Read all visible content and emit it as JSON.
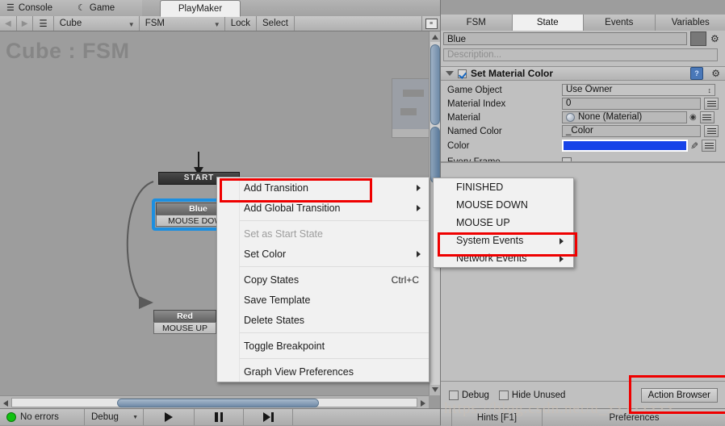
{
  "window_tabs": [
    {
      "label": "Console",
      "icon": "console-icon",
      "active": false
    },
    {
      "label": "Game",
      "icon": "game-icon",
      "active": false
    },
    {
      "label": "PlayMaker",
      "icon": "",
      "active": true
    }
  ],
  "graph_toolbar": {
    "back_icon": "left-arrow-icon",
    "forward_icon": "right-arrow-icon",
    "menu_icon": "hamburger-icon",
    "object_dropdown": "Cube",
    "fsm_dropdown": "FSM",
    "lock_label": "Lock",
    "select_label": "Select",
    "layout_icon": "layout-icon"
  },
  "graph": {
    "title": "Cube : FSM",
    "start_node": "START",
    "states": [
      {
        "name": "Blue",
        "event": "MOUSE DOWN",
        "selected": true
      },
      {
        "name": "Red",
        "event": "MOUSE UP",
        "selected": false
      }
    ]
  },
  "context_menu": {
    "items": [
      {
        "label": "Add Transition",
        "submenu": true,
        "disabled": false,
        "shortcut": "",
        "highlighted": true
      },
      {
        "label": "Add Global Transition",
        "submenu": true,
        "disabled": false,
        "shortcut": ""
      },
      {
        "separator": true
      },
      {
        "label": "Set as Start State",
        "submenu": false,
        "disabled": true,
        "shortcut": ""
      },
      {
        "label": "Set Color",
        "submenu": true,
        "disabled": false,
        "shortcut": ""
      },
      {
        "separator": true
      },
      {
        "label": "Copy States",
        "submenu": false,
        "disabled": false,
        "shortcut": "Ctrl+C"
      },
      {
        "label": "Save Template",
        "submenu": false,
        "disabled": false,
        "shortcut": ""
      },
      {
        "label": "Delete States",
        "submenu": false,
        "disabled": false,
        "shortcut": ""
      },
      {
        "separator": true
      },
      {
        "label": "Toggle Breakpoint",
        "submenu": false,
        "disabled": false,
        "shortcut": ""
      },
      {
        "separator": true
      },
      {
        "label": "Graph View Preferences",
        "submenu": false,
        "disabled": false,
        "shortcut": ""
      }
    ]
  },
  "submenu": {
    "items": [
      {
        "label": "FINISHED",
        "submenu": false
      },
      {
        "label": "MOUSE DOWN",
        "submenu": false
      },
      {
        "label": "MOUSE UP",
        "submenu": false
      },
      {
        "label": "System Events",
        "submenu": true,
        "highlighted": true
      },
      {
        "label": "Network Events",
        "submenu": true
      }
    ]
  },
  "status_bar": {
    "error_status": "No errors",
    "debug_label": "Debug",
    "play_icon": "play-icon",
    "pause_icon": "pause-icon",
    "step_icon": "step-icon"
  },
  "inspector": {
    "tabs": [
      {
        "label": "FSM",
        "active": false
      },
      {
        "label": "State",
        "active": true
      },
      {
        "label": "Events",
        "active": false
      },
      {
        "label": "Variables",
        "active": false
      }
    ],
    "state_name": "Blue",
    "description_placeholder": "Description...",
    "action": {
      "title": "Set Material Color",
      "enabled": true,
      "help_icon": "help-book-icon",
      "gear_icon": "gear-icon",
      "properties": [
        {
          "label": "Game Object",
          "value": "Use Owner",
          "type": "dropdown"
        },
        {
          "label": "Material Index",
          "value": "0",
          "type": "text"
        },
        {
          "label": "Material",
          "value": "None (Material)",
          "type": "object"
        },
        {
          "label": "Named Color",
          "value": "_Color",
          "type": "text"
        },
        {
          "label": "Color",
          "value": "",
          "type": "color",
          "color_hex": "#1743e8"
        },
        {
          "label": "Every Frame",
          "value": "",
          "type": "checkbox",
          "checked": false
        }
      ]
    },
    "bottom_options": [
      {
        "label": "Debug",
        "checked": false
      },
      {
        "label": "Hide Unused",
        "checked": false
      }
    ],
    "action_browser_label": "Action Browser",
    "hints_label": "Hints [F1]",
    "preferences_label": "Preferences"
  },
  "watermark": "https://blog.csdn.net/u_xxxxxxxx",
  "colors": {
    "selection_blue": "#1d8fe0",
    "highlight_red": "#ef0000",
    "swatch_blue": "#1743e8"
  }
}
